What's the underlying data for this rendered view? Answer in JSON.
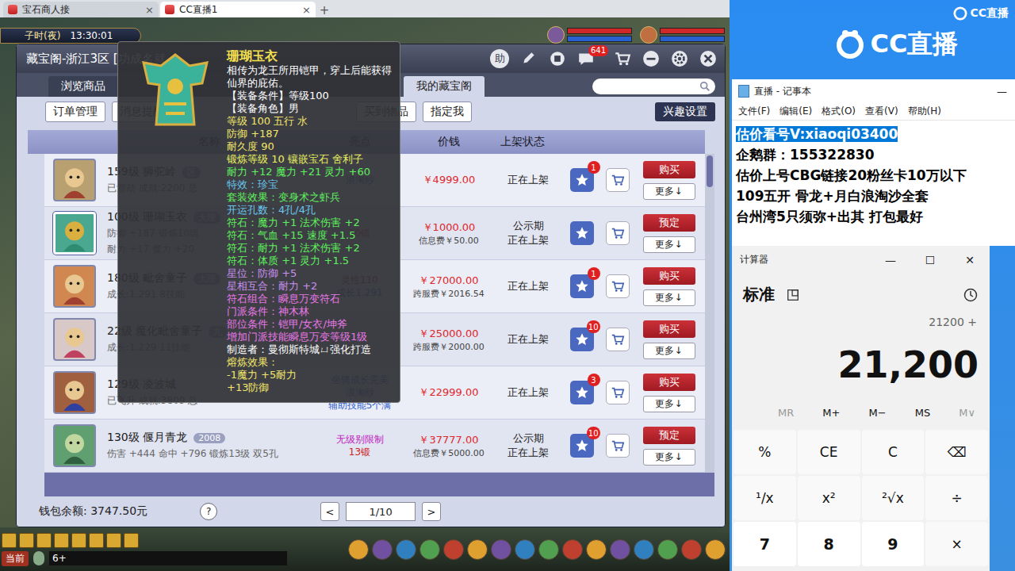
{
  "browser": {
    "tabs": [
      {
        "label": "宝石商人接",
        "close": "×",
        "selected": false
      },
      {
        "label": "CC直播1",
        "close": "×",
        "selected": true
      }
    ],
    "new_tab": "+"
  },
  "hud": {
    "period": "子时(夜)",
    "clock": "13:30:01"
  },
  "market": {
    "title": "藏宝阁-浙江3区 [功成名就",
    "help": "助",
    "message_badge": "641",
    "tabs": [
      {
        "label": "浏览商品",
        "selected": false
      },
      {
        "label": "我的藏宝阁",
        "selected": true
      }
    ],
    "actions_left": [
      "订单管理",
      "消息提醒"
    ],
    "actions_right": [
      "买到物品",
      "指定我"
    ],
    "interest": "兴趣设置",
    "columns": [
      "名称",
      "亮点",
      "价钱",
      "上架状态"
    ],
    "rows": [
      {
        "name": "159级 狮驼岭",
        "tag": "区",
        "details": [
          "已渡劫 成就:2200 总"
        ],
        "highlights": [
          {
            "text": "浪淘纱",
            "color": "#2f5fd0"
          }
        ],
        "price": "￥4999.00",
        "fee": null,
        "status": [
          "正在上架"
        ],
        "favorites": "1",
        "action": "购买",
        "more": "更多↓",
        "selected": false
      },
      {
        "name": "100级 珊瑚玉衣",
        "tag": "大理",
        "details": [
          "防御 +187 锻炼10级",
          "耐力 +17 魔力 +20"
        ],
        "highlights": [
          {
            "text": "10锻",
            "color": "#d02020"
          }
        ],
        "price": "￥1000.00",
        "fee": "信息费￥50.00",
        "status": [
          "公示期",
          "正在上架"
        ],
        "favorites": null,
        "action": "预定",
        "more": "更多↓",
        "selected": true
      },
      {
        "name": "180级 毗舍童子",
        "tag": "大理",
        "details": [
          "成长:1.291 8技能"
        ],
        "highlights": [
          {
            "text": "灵性110",
            "color": "#b01818"
          },
          {
            "text": "成长1.291",
            "color": "#2f5fd0"
          }
        ],
        "price": "￥27000.00",
        "fee": "跨服费￥2016.54",
        "status": [
          "正在上架"
        ],
        "favorites": "1",
        "action": "购买",
        "more": "更多↓",
        "selected": false
      },
      {
        "name": "22级 魔化毗舍童子",
        "tag": "九",
        "details": [
          "成长:1.229 11技能"
        ],
        "highlights": [],
        "price": "￥25000.00",
        "fee": "跨服费￥2000.00",
        "status": [
          "正在上架"
        ],
        "favorites": "10",
        "action": "购买",
        "more": "更多↓",
        "selected": false
      },
      {
        "name": "129级 凌波城",
        "tag": null,
        "details": [
          "已飞升 成就:3809 总"
        ],
        "highlights": [
          {
            "text": "坐骑成长完美",
            "color": "#2f5fd0"
          },
          {
            "text": "浪淘纱",
            "color": "#2f5fd0"
          },
          {
            "text": "辅助技能5个满",
            "color": "#2f5fd0"
          }
        ],
        "price": "￥22999.00",
        "fee": null,
        "status": [
          "正在上架"
        ],
        "favorites": "3",
        "action": "购买",
        "more": "更多↓",
        "selected": false
      },
      {
        "name": "130级 偃月青龙",
        "tag": "2008",
        "details": [
          "伤害 +444 命中 +796 锻炼13级 双5孔"
        ],
        "highlights": [
          {
            "text": "无级别限制",
            "color": "#c020c0"
          },
          {
            "text": "13锻",
            "color": "#d02020"
          }
        ],
        "price": "￥37777.00",
        "fee": "信息费￥5000.00",
        "status": [
          "公示期",
          "正在上架"
        ],
        "favorites": "10",
        "action": "预定",
        "more": "更多↓",
        "selected": false
      }
    ],
    "wallet": "钱包余额: 3747.50元",
    "help_mark": "?",
    "prev": "<",
    "page": "1/10",
    "next": ">"
  },
  "tooltip": {
    "title": "珊瑚玉衣",
    "description": "相传为龙王所用铠甲，穿上后能获得仙界的庇佑。",
    "lines": [
      {
        "text": "【装备条件】等级100",
        "color": "#ffffff"
      },
      {
        "text": "【装备角色】男",
        "color": "#ffffff"
      },
      {
        "text": "等级 100  五行 水",
        "color": "#f2e66a"
      },
      {
        "text": "防御 +187",
        "color": "#f2e66a"
      },
      {
        "text": "耐久度 90",
        "color": "#f2e66a"
      },
      {
        "text": "锻炼等级 10  镶嵌宝石 舍利子",
        "color": "#e8f060"
      },
      {
        "text": "耐力 +12 魔力 +21 灵力 +60",
        "color": "#5ef05e"
      },
      {
        "text": "特效：珍宝",
        "color": "#68c8f0"
      },
      {
        "text": "套装效果：变身术之虾兵",
        "color": "#5ef05e"
      },
      {
        "text": "开运孔数：4孔/4孔",
        "color": "#68c8f0"
      },
      {
        "text": "符石：魔力 +1 法术伤害 +2",
        "color": "#5ef05e"
      },
      {
        "text": "符石：气血 +15 速度 +1.5",
        "color": "#5ef05e"
      },
      {
        "text": "符石：耐力 +1 法术伤害 +2",
        "color": "#5ef05e"
      },
      {
        "text": "符石：体质 +1 灵力 +1.5",
        "color": "#5ef05e"
      },
      {
        "text": "星位：防御 +5",
        "color": "#c890f0"
      },
      {
        "text": "星相互合：耐力 +2",
        "color": "#c890f0"
      },
      {
        "text": "符石组合：瞬息万变符石",
        "color": "#e878e8"
      },
      {
        "text": "门派条件：神木林",
        "color": "#e878e8"
      },
      {
        "text": "部位条件：铠甲/女衣/坤斧",
        "color": "#e878e8"
      },
      {
        "text": "增加门派技能瞬息万变等级1级",
        "color": "#e878e8"
      },
      {
        "text": "制造者：曼彻斯特城ㄩ强化打造",
        "color": "#ffffff"
      },
      {
        "text": "熔炼效果：",
        "color": "#f2e66a"
      },
      {
        "text": "-1魔力 +5耐力",
        "color": "#f2e66a"
      },
      {
        "text": "+13防御",
        "color": "#f2e66a"
      }
    ]
  },
  "game_bar": {
    "channel": "当前",
    "input": "6+"
  },
  "stream": {
    "brand_small": "CC直播",
    "brand_large": "CC直播"
  },
  "notepad": {
    "title": "直播 - 记事本",
    "controls": [
      "—"
    ],
    "menu": [
      "文件(F)",
      "编辑(E)",
      "格式(O)",
      "查看(V)",
      "帮助(H)"
    ],
    "lines": [
      {
        "text": "估价看号V:xiaoqi03400",
        "selected": true
      },
      {
        "text": "企鹅群：155322830",
        "selected": false
      },
      {
        "text": "估价上号CBG链接20粉丝卡10万以下",
        "selected": false
      },
      {
        "text": "109五开 骨龙+月白浪淘沙全套",
        "selected": false
      },
      {
        "text": "台州湾5只须弥+出其 打包最好",
        "selected": false
      }
    ]
  },
  "calculator": {
    "title": "计算器",
    "controls": [
      "—",
      "☐",
      "✕"
    ],
    "mode": "标准",
    "expression": "21200 +",
    "display": "21,200",
    "memory": [
      {
        "label": "MR",
        "disabled": true
      },
      {
        "label": "M+",
        "disabled": false
      },
      {
        "label": "M−",
        "disabled": false
      },
      {
        "label": "MS",
        "disabled": false
      },
      {
        "label": "M∨",
        "disabled": true
      }
    ],
    "keys": [
      {
        "label": "%",
        "kind": "op"
      },
      {
        "label": "CE",
        "kind": "op"
      },
      {
        "label": "C",
        "kind": "op"
      },
      {
        "label": "⌫",
        "kind": "op"
      },
      {
        "label": "¹/x",
        "kind": "op"
      },
      {
        "label": "x²",
        "kind": "op"
      },
      {
        "label": "²√x",
        "kind": "op"
      },
      {
        "label": "÷",
        "kind": "op"
      },
      {
        "label": "7",
        "kind": "digit"
      },
      {
        "label": "8",
        "kind": "digit"
      },
      {
        "label": "9",
        "kind": "digit"
      },
      {
        "label": "×",
        "kind": "op"
      }
    ]
  }
}
